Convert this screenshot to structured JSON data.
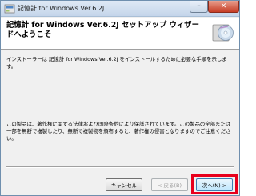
{
  "window": {
    "title": "記憶計 for Windows Ver.6.2J",
    "minimize_glyph": "–",
    "close_glyph": "✕"
  },
  "banner": {
    "heading": "記憶計 for Windows Ver.6.2J セットアップ ウィザードへようこそ"
  },
  "body": {
    "intro": "インストーラーは 記憶計 for Windows Ver.6.2J をインストールするために必要な手順を示します。",
    "copyright": "この製品は、著作権に関する法律および国際条約により保護されています。この製品の全部または一部を無断で複製したり、無断で複製物を頒布すると、著作権の侵害となりますのでご注意ください。"
  },
  "buttons": {
    "cancel": "キャンセル",
    "back": "< 戻る(B)",
    "next": "次へ(N) >"
  },
  "colors": {
    "highlight": "#e8001c"
  }
}
